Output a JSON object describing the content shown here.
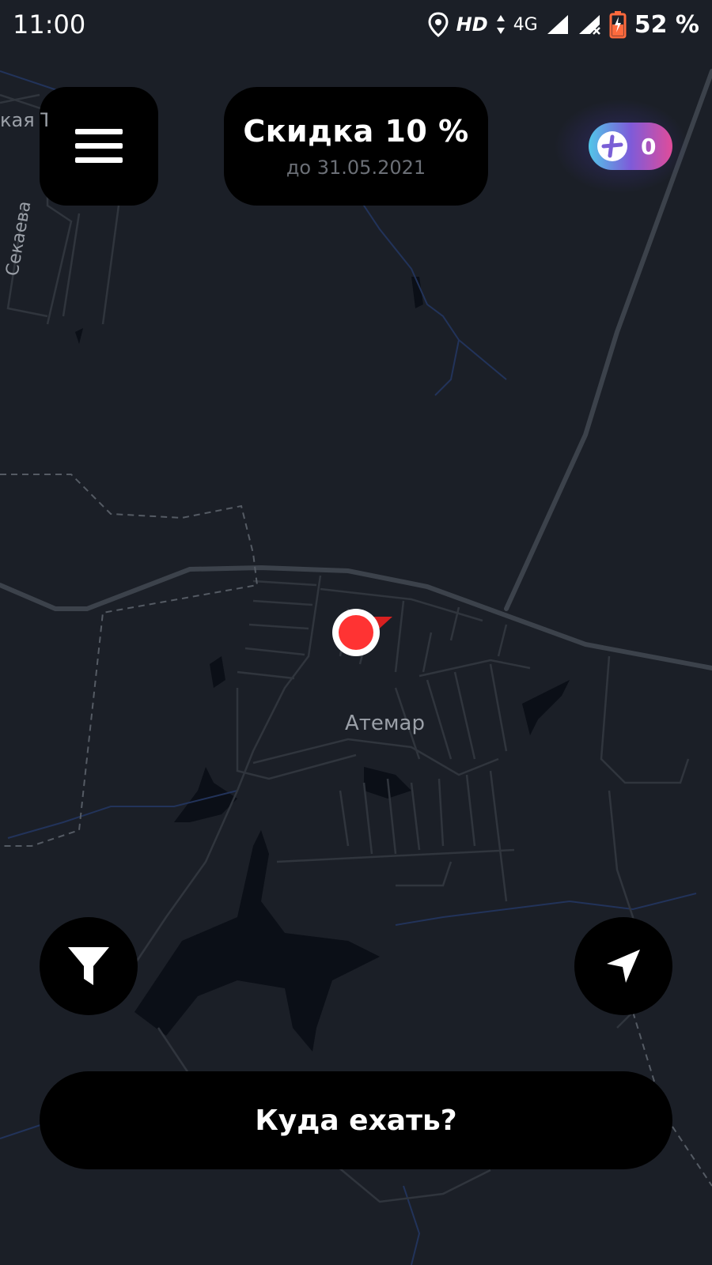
{
  "status_bar": {
    "time": "11:00",
    "hd": "HD",
    "network": "4G",
    "battery_percent": "52 %",
    "icons": [
      "location-icon",
      "hd-icon",
      "data-arrows-icon",
      "signal-icon",
      "signal-no-service-icon",
      "battery-charging-icon"
    ]
  },
  "menu": {
    "icon": "hamburger-icon"
  },
  "promo": {
    "title": "Скидка 10 %",
    "subtitle": "до 31.05.2021"
  },
  "plus": {
    "icon": "plus-icon",
    "count": "0"
  },
  "map": {
    "place_label": "Атемар",
    "street_labels": [
      "кая Т",
      "Секаева"
    ],
    "background_color": "#1b1f27",
    "road_color": "#3a4049",
    "water_color": "#0b0f17",
    "marker_color": "#ff3333"
  },
  "controls": {
    "filter_icon": "filter-icon",
    "locate_icon": "navigation-arrow-icon"
  },
  "destination": {
    "label": "Куда ехать?"
  }
}
